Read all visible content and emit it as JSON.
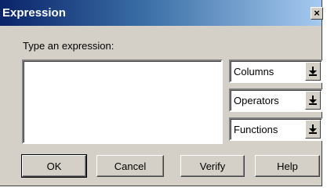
{
  "window": {
    "title": "Expression",
    "close_glyph": "×"
  },
  "prompt": {
    "label": "Type an expression:",
    "value": ""
  },
  "dropdowns": [
    {
      "label": "Columns",
      "icon": "dropdown-arrow-icon"
    },
    {
      "label": "Operators",
      "icon": "dropdown-arrow-icon"
    },
    {
      "label": "Functions",
      "icon": "dropdown-arrow-icon"
    }
  ],
  "buttons": {
    "ok": "OK",
    "cancel": "Cancel",
    "verify": "Verify",
    "help": "Help"
  },
  "colors": {
    "title_start": "#0a246a",
    "title_end": "#a6caf0",
    "dialog_face": "#d4d0c8"
  }
}
